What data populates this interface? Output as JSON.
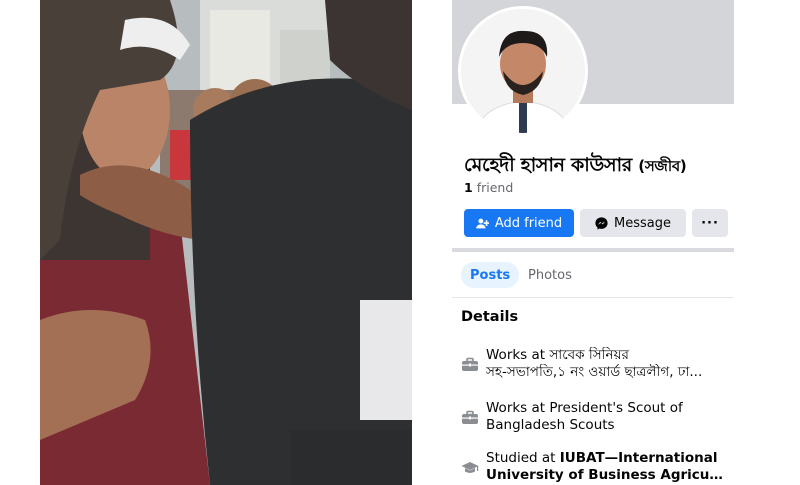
{
  "profile": {
    "name": "মেহেদী হাসান কাউসার",
    "alternate_name": "(সজীব)",
    "friend_count": "1",
    "friend_label": "friend",
    "buttons": {
      "add_friend": "Add friend",
      "message": "Message",
      "more": "···"
    },
    "tabs": [
      {
        "label": "Posts",
        "active": true
      },
      {
        "label": "Photos",
        "active": false
      }
    ],
    "details_title": "Details",
    "details": [
      {
        "icon": "briefcase-icon",
        "line1": "Works at সাবেক সিনিয়র",
        "line2": "সহ-সভাপতি,১ নং ওয়ার্ড ছাত্রলীগ, ঢা..."
      },
      {
        "icon": "briefcase-icon",
        "line1": "Works at President's Scout of",
        "line2": "Bangladesh Scouts"
      },
      {
        "icon": "graduation-cap-icon",
        "prefix": "Studied at ",
        "bold1": "IUBAT—International",
        "line2": "University of Business Agricultur..."
      }
    ]
  },
  "colors": {
    "accent": "#1877f2",
    "cover": "#d3d5d8",
    "button_gray": "#e4e6eb",
    "secondary_text": "#65676b"
  }
}
